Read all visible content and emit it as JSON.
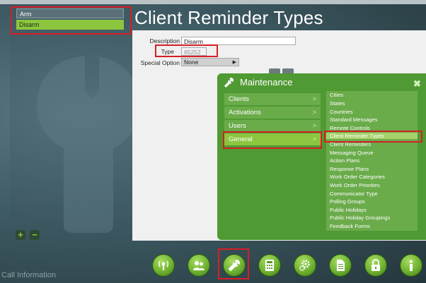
{
  "page_title": "Client Reminder Types",
  "list": {
    "items": [
      {
        "label": "Arm",
        "selected": false
      },
      {
        "label": "Disarm",
        "selected": true
      }
    ]
  },
  "form": {
    "description": {
      "label": "Description",
      "value": "Disarm"
    },
    "type": {
      "label": "Type",
      "value": "65252"
    },
    "special_option": {
      "label": "Special Option",
      "value": "None"
    }
  },
  "maintenance": {
    "title": "Maintenance",
    "close_label": "✖",
    "categories": [
      {
        "label": "Clients",
        "chevron": ">"
      },
      {
        "label": "Activations",
        "chevron": ">"
      },
      {
        "label": "Users",
        "chevron": ">"
      },
      {
        "label": "General",
        "chevron": ">",
        "active": true
      }
    ],
    "general_items": [
      "Cities",
      "States",
      "Countries",
      "Standard Messages",
      "Remote Controls",
      "Client Reminder Types",
      "Client Reminders",
      "Messaging Queue",
      "Action Plans",
      "Response Plans",
      "Work Order Categories",
      "Work Order Priorities",
      "Communicator Type",
      "Polling Groups",
      "Public Holidays",
      "Public Holiday Groupings",
      "Feedback Forms"
    ]
  },
  "footer": {
    "text": "Call Information"
  },
  "dock": {
    "buttons": [
      "satellite-icon",
      "users-icon",
      "wrench-icon",
      "calculator-icon",
      "gears-icon",
      "document-icon",
      "lock-icon",
      "info-icon"
    ]
  },
  "side_controls": {
    "add": "+",
    "remove": "−"
  },
  "colors": {
    "accent_green": "#8cc63f",
    "panel_green": "#4f9a32",
    "highlight_red": "#d61f26"
  }
}
